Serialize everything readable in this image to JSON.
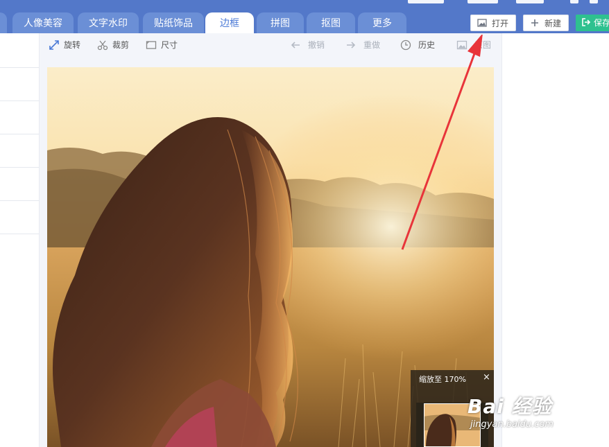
{
  "tabs": [
    {
      "label": "人像美容",
      "active": false
    },
    {
      "label": "文字水印",
      "active": false
    },
    {
      "label": "贴纸饰品",
      "active": false
    },
    {
      "label": "边框",
      "active": true
    },
    {
      "label": "拼图",
      "active": false
    },
    {
      "label": "抠图",
      "active": false
    },
    {
      "label": "更多",
      "active": false
    }
  ],
  "header_buttons": {
    "open": {
      "label": "打开",
      "icon": "image-icon"
    },
    "new": {
      "label": "新建",
      "icon": "plus-icon"
    },
    "save": {
      "label": "保存",
      "icon": "export-icon"
    }
  },
  "toolbar": {
    "rotate": {
      "label": "旋转",
      "icon": "rotate-icon"
    },
    "crop": {
      "label": "裁剪",
      "icon": "scissors-icon"
    },
    "size": {
      "label": "尺寸",
      "icon": "resize-icon"
    },
    "undo": {
      "label": "撤销",
      "icon": "undo-arrow-icon"
    },
    "redo": {
      "label": "重做",
      "icon": "redo-arrow-icon"
    },
    "history": {
      "label": "历史",
      "icon": "clock-icon"
    },
    "original": {
      "label": "原图",
      "icon": "image-icon"
    }
  },
  "navigator": {
    "title": "缩放至  170%",
    "close": "×"
  },
  "watermark": {
    "logo": "Bai 经验",
    "url": "jingyan.baidu.com"
  },
  "colors": {
    "tab_bar": "#5378c9",
    "tab": "#6b8fd6",
    "active_tab_text": "#4a79d6",
    "save_button": "#2ec18f",
    "annotation_arrow": "#e8343a"
  }
}
